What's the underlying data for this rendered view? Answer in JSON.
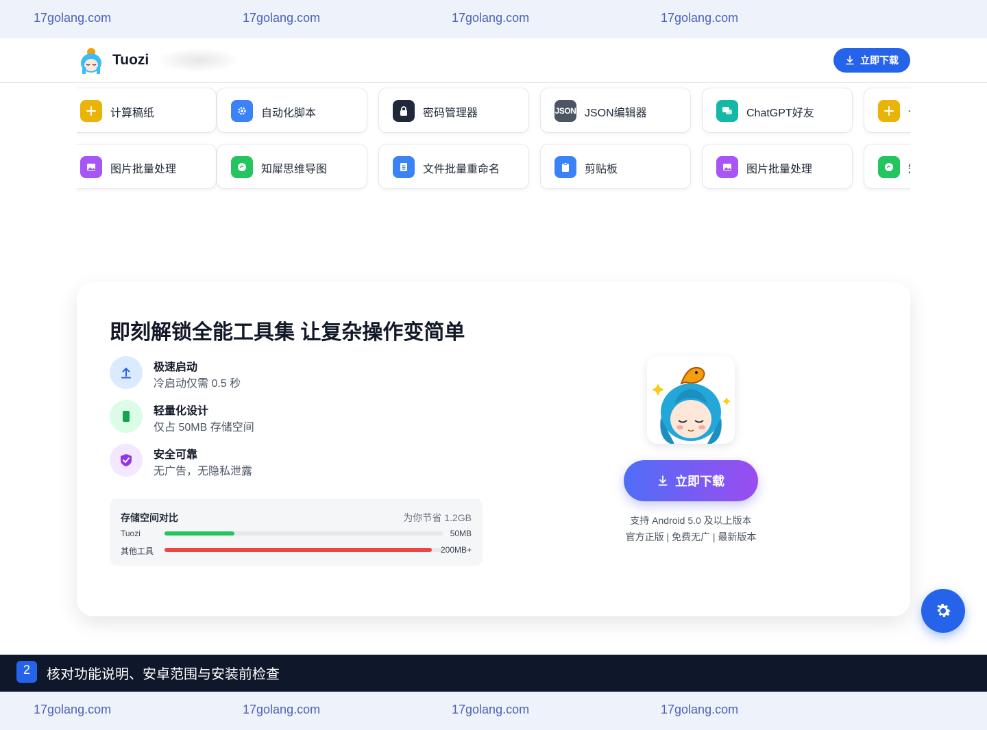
{
  "watermark": {
    "text": "17golang.com"
  },
  "header": {
    "brand": "Tuozi",
    "download_label": "立即下载",
    "logo_icon": "anime-girl-avatar-icon"
  },
  "tools": {
    "row1": [
      {
        "label": "计算稿纸",
        "icon": "plus-icon",
        "color": "#eab308"
      },
      {
        "label": "自动化脚本",
        "icon": "gear-icon",
        "color": "#3b82f6"
      },
      {
        "label": "密码管理器",
        "icon": "lock-icon",
        "color": "#1f2937"
      },
      {
        "label": "JSON编辑器",
        "icon": "json-icon",
        "icon_text": "JSON",
        "color": "#4b5563"
      },
      {
        "label": "ChatGPT好友",
        "icon": "chat-icon",
        "color": "#14b8a6"
      },
      {
        "label": "计",
        "icon": "plus-icon",
        "color": "#eab308"
      }
    ],
    "row2": [
      {
        "label": "图片批量处理",
        "icon": "image-icon",
        "color": "#a855f7"
      },
      {
        "label": "知犀思维导图",
        "icon": "mindmap-icon",
        "color": "#22c55e"
      },
      {
        "label": "文件批量重命名",
        "icon": "file-list-icon",
        "color": "#3b82f6"
      },
      {
        "label": "剪贴板",
        "icon": "clipboard-icon",
        "color": "#3b82f6"
      },
      {
        "label": "图片批量处理",
        "icon": "image-icon",
        "color": "#a855f7"
      },
      {
        "label": "知",
        "icon": "mindmap-icon",
        "color": "#22c55e"
      }
    ]
  },
  "promo": {
    "title": "即刻解锁全能工具集 让复杂操作变简单",
    "features": [
      {
        "title": "极速启动",
        "desc": "冷启动仅需 0.5 秒",
        "icon": "upload-arrow-icon",
        "bg": "#dbeafe",
        "fg": "#2563eb"
      },
      {
        "title": "轻量化设计",
        "desc": "仅占 50MB 存储空间",
        "icon": "phone-icon",
        "bg": "#dcfce7",
        "fg": "#16a34a"
      },
      {
        "title": "安全可靠",
        "desc": "无广告，无隐私泄露",
        "icon": "shield-check-icon",
        "bg": "#f3e8ff",
        "fg": "#9333ea"
      }
    ],
    "compare": {
      "title": "存储空间对比",
      "saving": "为你节省 1.2GB",
      "rows": [
        {
          "name": "Tuozi",
          "value": "50MB",
          "fraction": 0.25,
          "color": "#22c55e"
        },
        {
          "name": "其他工具",
          "value": "200MB+",
          "fraction": 0.96,
          "color": "#ef4444"
        }
      ]
    },
    "download_label": "立即下载",
    "support": "支持 Android 5.0 及以上版本",
    "badges": "官方正版 | 免费无广 | 最新版本"
  },
  "fab": {
    "icon": "gear-icon"
  },
  "banner": {
    "number": "2",
    "text": "核对功能说明、安卓范围与安装前检查"
  }
}
